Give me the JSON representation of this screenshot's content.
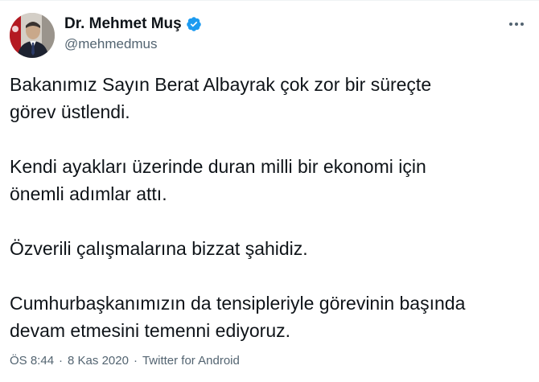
{
  "tweet": {
    "author": {
      "display_name": "Dr. Mehmet Muş",
      "handle": "@mehmedmus",
      "verified": true,
      "verified_color": "#1d9bf0"
    },
    "paragraphs": [
      "Bakanımız Sayın Berat Albayrak çok zor bir süreçte\ngörev üstlendi.",
      "Kendi ayakları üzerinde duran milli bir ekonomi için\nönemli adımlar attı.",
      "Özverili çalışmalarına bizzat şahidiz.",
      "Cumhurbaşkanımızın da tensipleriyle görevinin başında\ndevam etmesini temenni ediyoruz."
    ],
    "time": "ÖS 8:44",
    "separator": "·",
    "date": "8 Kas 2020",
    "source": "Twitter for Android"
  },
  "icons": {
    "avatar": "profile-photo",
    "verified": "verified-badge-icon",
    "more": "more-options-icon"
  }
}
